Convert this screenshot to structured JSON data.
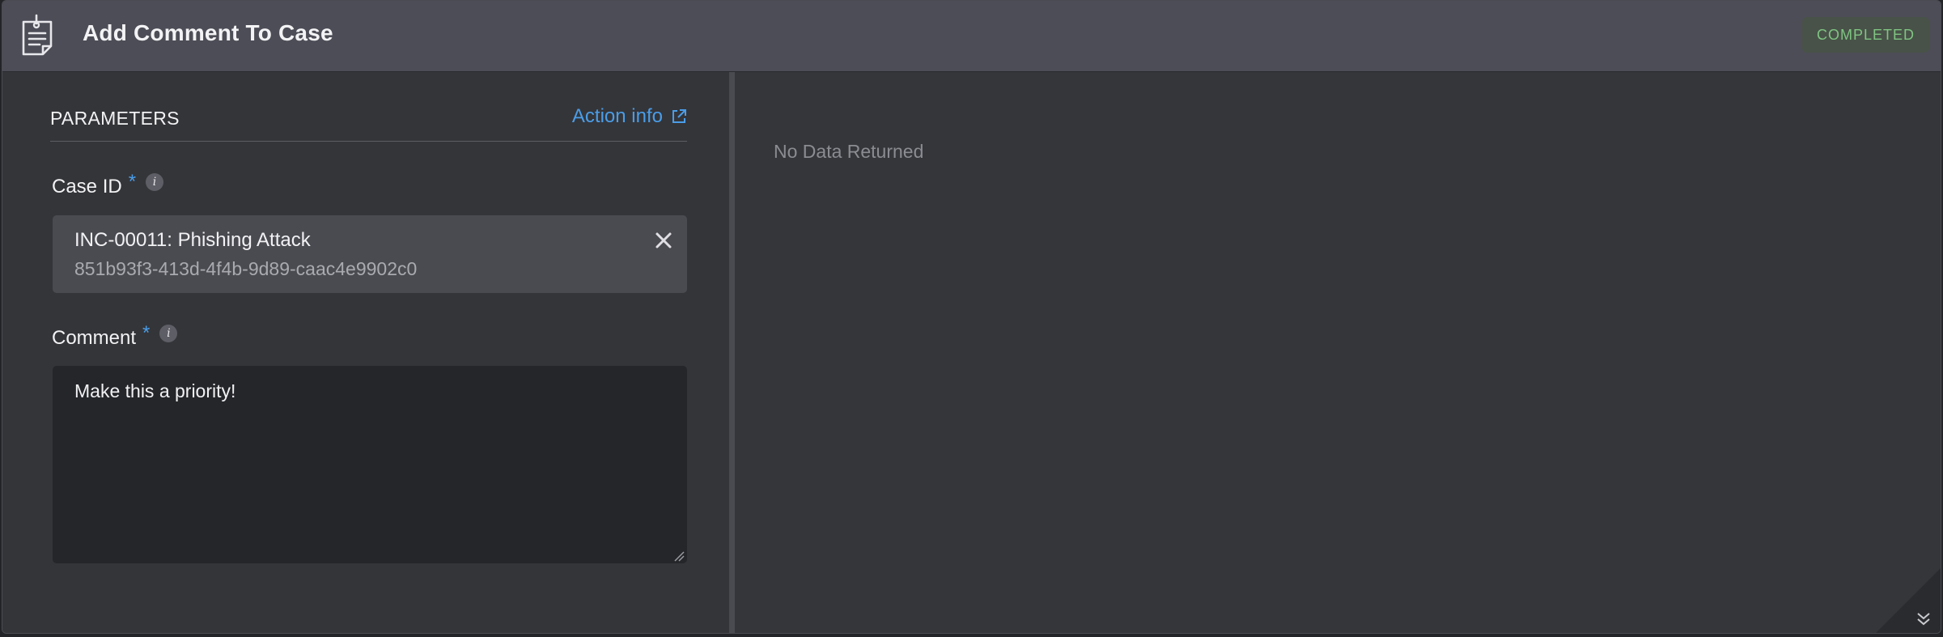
{
  "header": {
    "title": "Add Comment To Case",
    "icon": "clipboard-note-icon",
    "status": "COMPLETED"
  },
  "parameters": {
    "section_title": "PARAMETERS",
    "action_info": "Action info",
    "action_info_icon": "external-link-icon",
    "case_id": {
      "label": "Case ID",
      "required": "*",
      "info_glyph": "i",
      "primary": "INC-00011: Phishing Attack",
      "secondary": "851b93f3-413d-4f4b-9d89-caac4e9902c0"
    },
    "comment": {
      "label": "Comment",
      "required": "*",
      "info_glyph": "i",
      "value": "Make this a priority!"
    }
  },
  "results": {
    "message": "No Data Returned"
  },
  "colors": {
    "accent": "#4a9de8",
    "status_text": "#7fc482",
    "status_bg": "#485248"
  }
}
